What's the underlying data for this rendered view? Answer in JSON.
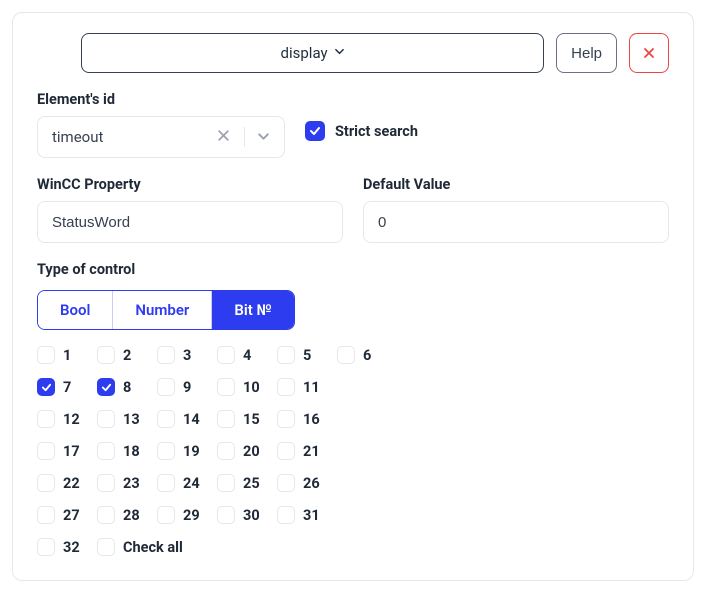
{
  "top": {
    "display_label": "display",
    "help_label": "Help"
  },
  "labels": {
    "element_id": "Element's id",
    "wincc_property": "WinCC Property",
    "default_value": "Default Value",
    "type_of_control": "Type of control",
    "strict_search": "Strict search"
  },
  "fields": {
    "element_id_value": "timeout",
    "wincc_property_value": "StatusWord",
    "default_value_value": "0",
    "strict_search_checked": true
  },
  "segments": {
    "bool": "Bool",
    "number": "Number",
    "bit": "Bit №",
    "active": "bit"
  },
  "bits": {
    "checked": [
      7,
      8
    ],
    "check_all_label": "Check all",
    "check_all_checked": false,
    "count": 32
  }
}
